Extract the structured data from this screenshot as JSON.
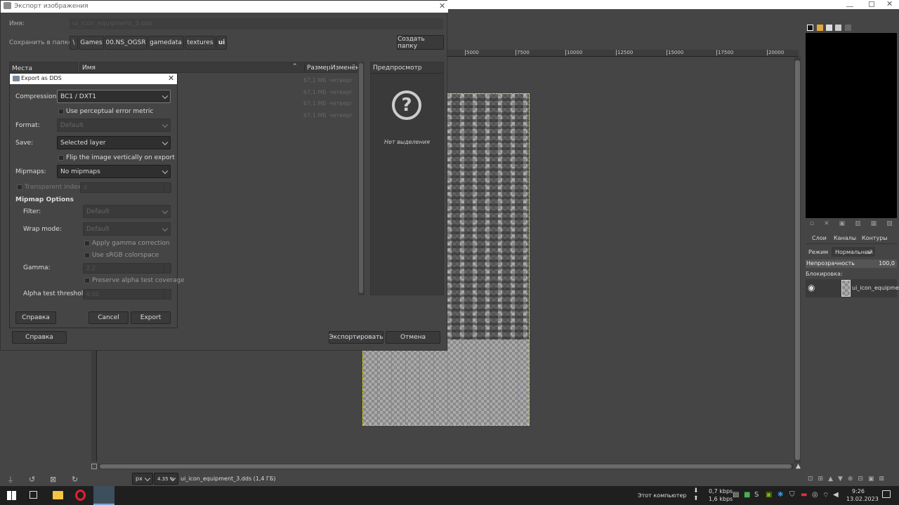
{
  "gimp": {
    "ruler_ticks": [
      "5000",
      "7500",
      "10000",
      "12500",
      "15000",
      "17500",
      "20000"
    ],
    "unit": "px",
    "zoom": "4.35 %",
    "status_text": "ui_icon_equipment_3.dds (1,4 ГБ)",
    "layers_panel": {
      "tabs": [
        "Слои",
        "Каналы",
        "Контуры"
      ],
      "mode_label": "Режим",
      "mode_value": "Нормальный",
      "opacity_label": "Непрозрачность",
      "opacity_value": "100,0",
      "lock_label": "Блокировка:",
      "layer_name": "ui_icon_equipment_"
    }
  },
  "export_dialog": {
    "title": "Экспорт изображения",
    "name_label": "Имя:",
    "name_value": "ui_icon_equipment_3.dds",
    "folder_label": "Сохранить в папке",
    "breadcrumbs": [
      "\\",
      "Games",
      "00.NS_OGSR",
      "gamedata",
      "textures",
      "ui"
    ],
    "create_folder": "Создать папку",
    "places_header": "Места",
    "cols": {
      "name": "Имя",
      "size": "Размер",
      "modified": "Изменён"
    },
    "files": [
      {
        "size": "67,1 МБ",
        "modified": "четверг"
      },
      {
        "size": "67,1 МБ",
        "modified": "четверг"
      },
      {
        "size": "67,1 МБ",
        "modified": "четверг"
      },
      {
        "size": "67,1 МБ",
        "modified": "четверг"
      }
    ],
    "preview_header": "Предпросмотр",
    "no_selection": "Нет выделения",
    "help": "Справка",
    "export": "Экспортировать",
    "cancel": "Отмена"
  },
  "dds_dialog": {
    "title": "Export as DDS",
    "compression_label": "Compression:",
    "compression_value": "BC1 / DXT1",
    "perceptual_label": "Use perceptual error metric",
    "format_label": "Format:",
    "format_value": "Default",
    "save_label": "Save:",
    "save_value": "Selected layer",
    "flip_label": "Flip the image vertically on export",
    "mipmaps_label": "Mipmaps:",
    "mipmaps_value": "No mipmaps",
    "transparent_label": "Transparent index:",
    "transparent_value": "0",
    "mipmap_options": "Mipmap Options",
    "filter_label": "Filter:",
    "filter_value": "Default",
    "wrap_label": "Wrap mode:",
    "wrap_value": "Default",
    "gamma_corr_label": "Apply gamma correction",
    "srgb_label": "Use sRGB colorspace",
    "gamma_label": "Gamma:",
    "gamma_value": "2,2",
    "preserve_label": "Preserve alpha test coverage",
    "alpha_label": "Alpha test threshold:",
    "alpha_value": "0,50",
    "help": "Справка",
    "cancel": "Cancel",
    "export": "Export"
  },
  "taskbar": {
    "computer_label": "Этот компьютер",
    "net_up": "0,7 kbps",
    "net_down": "1,6 kbps",
    "time": "9:26",
    "date": "13.02.2023"
  }
}
